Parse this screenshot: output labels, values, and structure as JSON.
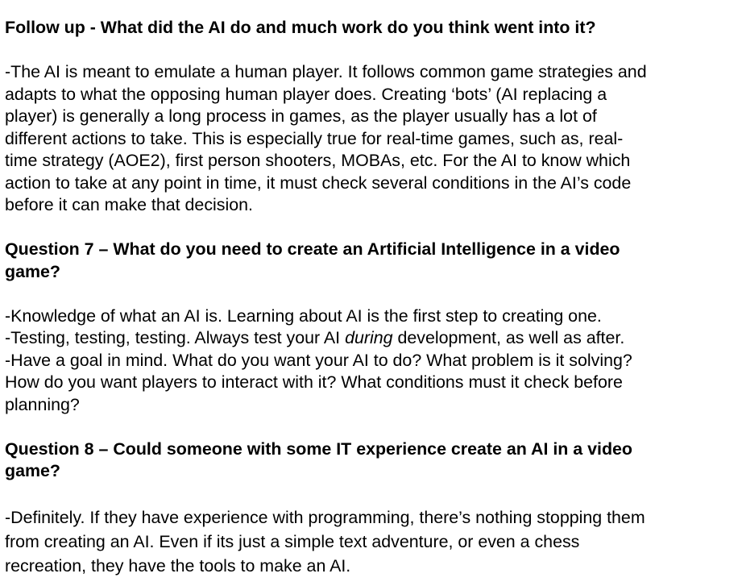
{
  "sections": [
    {
      "heading": "Follow up - What did the AI do and much work do you think went into it?",
      "answer_lines": [
        "-The AI is meant to emulate a human player. It follows common game strategies and",
        "adapts to what the opposing human player does. Creating ‘bots’ (AI replacing a",
        "player) is generally a long process in games, as the player usually has a lot of",
        "different actions to take. This is especially true for real-time games, such as, real-",
        "time strategy (AOE2), first person shooters, MOBAs, etc. For the AI to know which",
        "action to take at any point in time, it must check several conditions in the AI’s code",
        "before it can make that decision."
      ]
    },
    {
      "heading_lines": [
        "Question 7 – What do you need to create an Artificial Intelligence in a video",
        "game?"
      ],
      "answer_lines": [
        "-Knowledge of what an AI is. Learning about AI is the first step to creating one."
      ],
      "testing_line": {
        "before": "-Testing, testing, testing. Always test your AI ",
        "emphasis": "during",
        "after": " development, as well as after."
      },
      "goal_lines": [
        "-Have a goal in mind. What do you want your AI to do? What problem is it solving?",
        "How do you want players to interact with it? What conditions must it check before",
        "planning?"
      ]
    },
    {
      "heading_lines": [
        "Question 8 – Could someone with some IT experience create an AI in a video",
        "game?"
      ],
      "answer_lines": [
        "-Definitely. If they have experience with programming, there’s nothing stopping them",
        "from creating an AI. Even if its just a simple text adventure, or even a chess",
        "recreation, they have the tools to make an AI."
      ]
    }
  ]
}
